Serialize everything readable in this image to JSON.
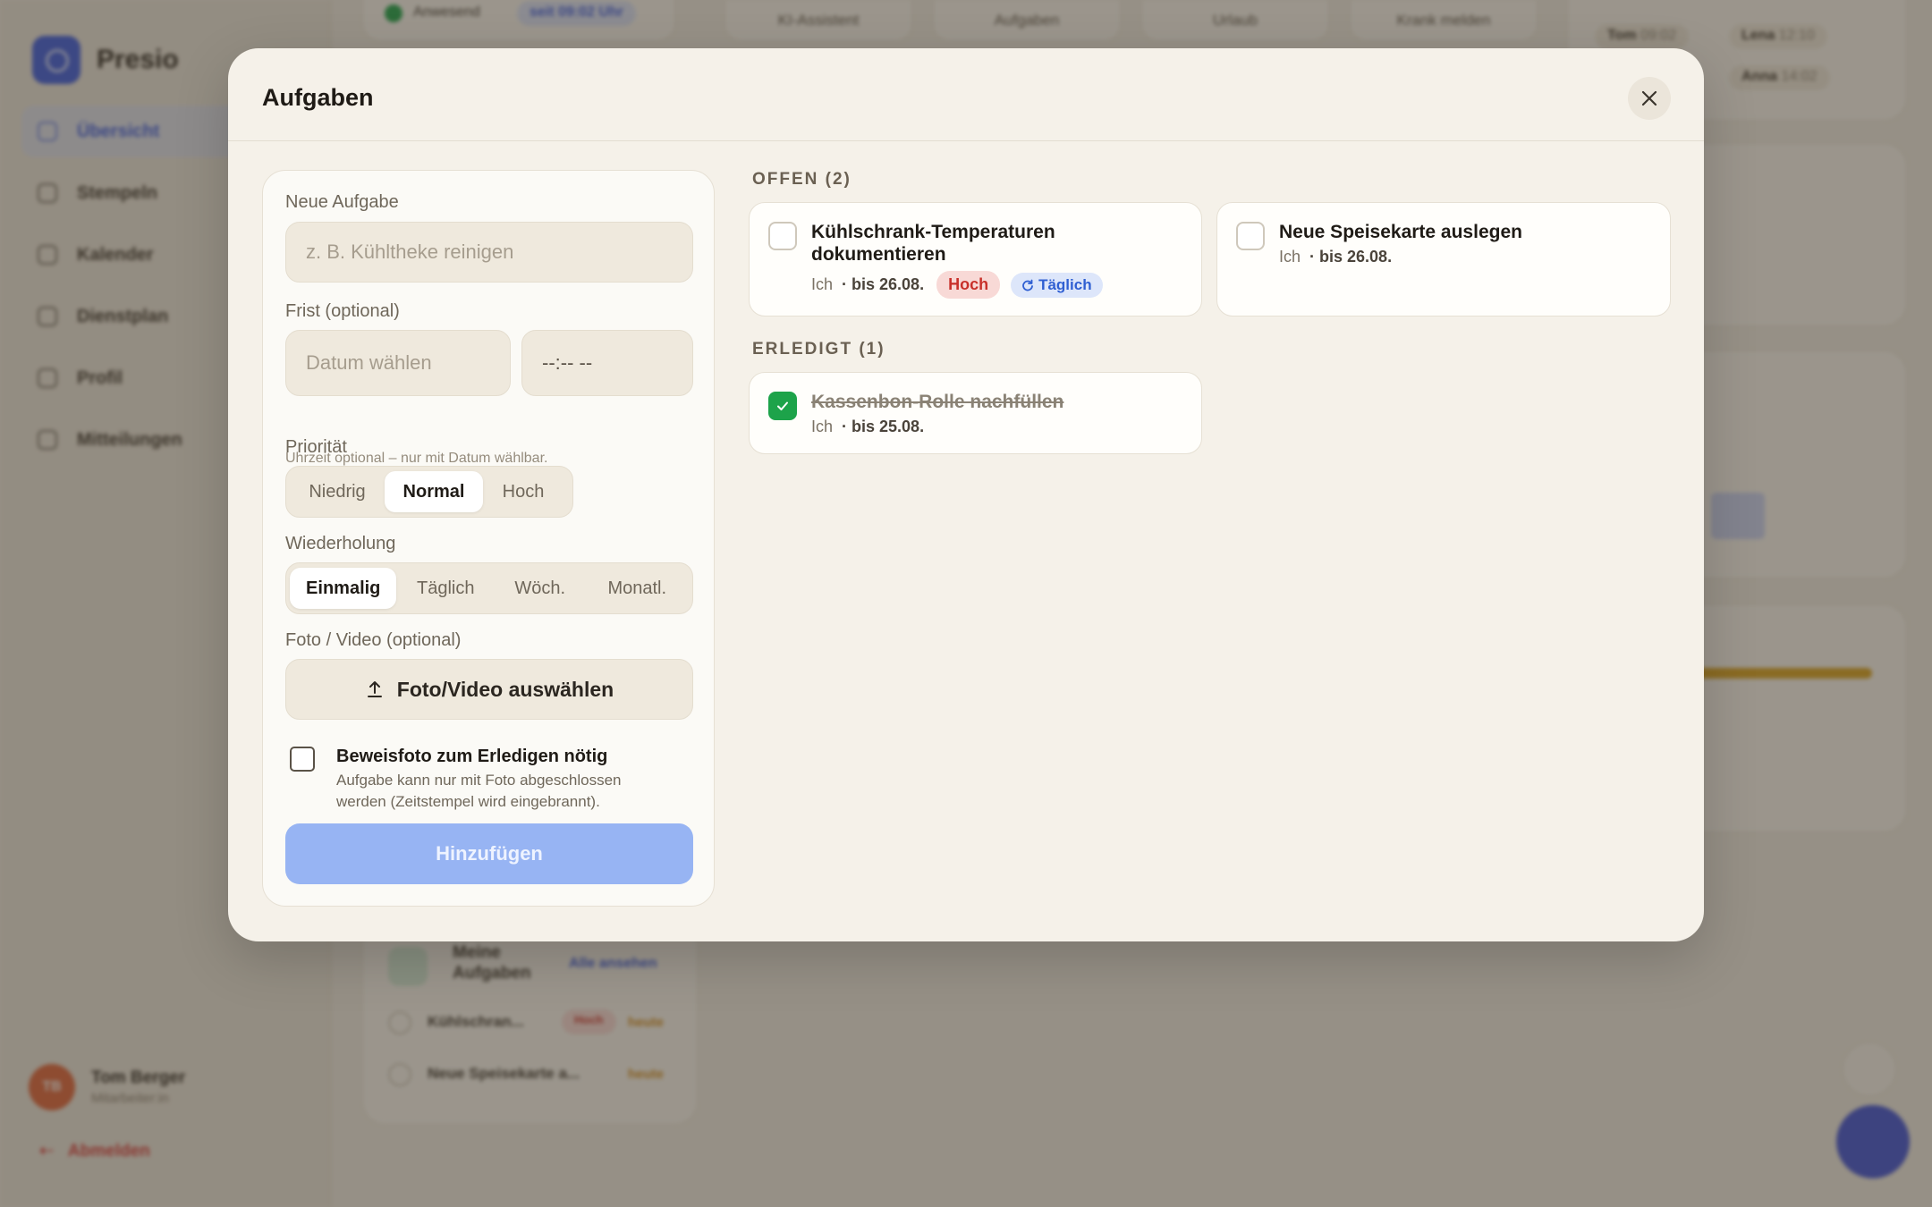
{
  "background": {
    "brand": "Presio",
    "nav": [
      "Übersicht",
      "Stempeln",
      "Kalender",
      "Dienstplan",
      "Profil",
      "Mitteilungen"
    ],
    "user": {
      "initials": "TB",
      "name": "Tom Berger",
      "role": "Mitarbeiter:in"
    },
    "logout": "Abmelden",
    "top_tabs": [
      "KI-Assistent",
      "Aufgaben",
      "Urlaub",
      "Krank melden"
    ],
    "status": "Anwesend",
    "since": "seit 09:02 Uhr",
    "team": [
      {
        "name": "Tom",
        "time": "09:02"
      },
      {
        "name": "Lena",
        "time": "12:10"
      },
      {
        "name": "Anna",
        "time": "14:02"
      }
    ],
    "my_tasks": {
      "title": "Meine Aufgaben",
      "link": "Alle ansehen",
      "items": [
        {
          "label": "Kühlschran...",
          "badge": "Hoch",
          "due": "heute"
        },
        {
          "label": "Neue Speisekarte a...",
          "due": "heute"
        }
      ]
    }
  },
  "modal": {
    "title": "Aufgaben",
    "close_label": "×",
    "form": {
      "new_task_label": "Neue Aufgabe",
      "new_task_placeholder": "z. B. Kühltheke reinigen",
      "deadline_label": "Frist (optional)",
      "date_placeholder": "Datum wählen",
      "time_placeholder": "--:-- --",
      "time_hint": "Uhrzeit optional – nur mit Datum wählbar.",
      "priority_label": "Priorität",
      "priority_options": [
        "Niedrig",
        "Normal",
        "Hoch"
      ],
      "priority_selected": "Normal",
      "repeat_label": "Wiederholung",
      "repeat_options": [
        "Einmalig",
        "Täglich",
        "Wöch.",
        "Monatl."
      ],
      "repeat_selected": "Einmalig",
      "media_label": "Foto / Video (optional)",
      "media_button": "Foto/Video auswählen",
      "proof_title": "Beweisfoto zum Erledigen nötig",
      "proof_desc": "Aufgabe kann nur mit Foto abgeschlossen werden (Zeitstempel wird eingebrannt).",
      "proof_checked": false,
      "submit_label": "Hinzufügen"
    },
    "open_section": "OFFEN (2)",
    "open_tasks": [
      {
        "title": "Kühlschrank-Temperaturen dokumentieren",
        "assignee": "Ich",
        "due": "· bis 26.08.",
        "priority": "Hoch",
        "repeat": "Täglich"
      },
      {
        "title": "Neue Speisekarte auslegen",
        "assignee": "Ich",
        "due": "· bis 26.08."
      }
    ],
    "done_section": "ERLEDIGT (1)",
    "done_tasks": [
      {
        "title": "Kassenbon-Rolle nachfüllen",
        "assignee": "Ich",
        "due": "· bis 25.08."
      }
    ]
  },
  "colors": {
    "accent": "#3d5ce0",
    "submit_disabled": "#97b4f3",
    "done_green": "#1da34a",
    "high_badge": "#c8302a",
    "repeat_badge": "#2f5fd2"
  }
}
